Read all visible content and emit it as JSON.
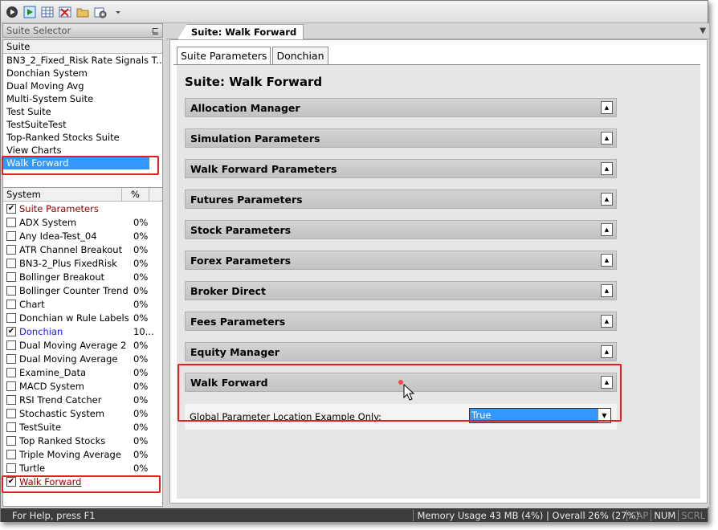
{
  "toolbar": {
    "icons": [
      "run-icon",
      "run-suite-icon",
      "grid-icon",
      "delete-grid-icon",
      "folder-icon",
      "settings-icon",
      "dropdown-arrow-icon"
    ]
  },
  "suite_selector": {
    "title": "Suite Selector",
    "pin_glyph": "⊑",
    "column_header": "Suite",
    "items": [
      {
        "label": "BN3_2_Fixed_Risk Rate Signals T..."
      },
      {
        "label": "Donchian System"
      },
      {
        "label": "Dual Moving Avg"
      },
      {
        "label": "Multi-System Suite"
      },
      {
        "label": "Test Suite"
      },
      {
        "label": "TestSuiteTest"
      },
      {
        "label": "Top-Ranked Stocks Suite"
      },
      {
        "label": "View Charts"
      },
      {
        "label": "Walk Forward"
      }
    ],
    "selected_index": 8
  },
  "system_list": {
    "col_system": "System",
    "col_pct": "%",
    "rows": [
      {
        "name": "Suite Parameters",
        "pct": "",
        "checked": true,
        "style": "red"
      },
      {
        "name": "ADX System",
        "pct": "0%",
        "checked": false,
        "style": ""
      },
      {
        "name": "Any Idea-Test_04",
        "pct": "0%",
        "checked": false,
        "style": ""
      },
      {
        "name": "ATR Channel Breakout",
        "pct": "0%",
        "checked": false,
        "style": ""
      },
      {
        "name": "BN3-2_Plus FixedRisk",
        "pct": "0%",
        "checked": false,
        "style": ""
      },
      {
        "name": "Bollinger Breakout",
        "pct": "0%",
        "checked": false,
        "style": ""
      },
      {
        "name": "Bollinger Counter Trend",
        "pct": "0%",
        "checked": false,
        "style": ""
      },
      {
        "name": "Chart",
        "pct": "0%",
        "checked": false,
        "style": ""
      },
      {
        "name": "Donchian w Rule Labels",
        "pct": "0%",
        "checked": false,
        "style": ""
      },
      {
        "name": "Donchian",
        "pct": "10...",
        "checked": true,
        "style": "blue"
      },
      {
        "name": "Dual Moving Average 2",
        "pct": "0%",
        "checked": false,
        "style": ""
      },
      {
        "name": "Dual Moving Average",
        "pct": "0%",
        "checked": false,
        "style": ""
      },
      {
        "name": "Examine_Data",
        "pct": "0%",
        "checked": false,
        "style": ""
      },
      {
        "name": "MACD System",
        "pct": "0%",
        "checked": false,
        "style": ""
      },
      {
        "name": "RSI Trend Catcher",
        "pct": "0%",
        "checked": false,
        "style": ""
      },
      {
        "name": "Stochastic System",
        "pct": "0%",
        "checked": false,
        "style": ""
      },
      {
        "name": "TestSuite",
        "pct": "0%",
        "checked": false,
        "style": ""
      },
      {
        "name": "Top Ranked Stocks",
        "pct": "0%",
        "checked": false,
        "style": ""
      },
      {
        "name": "Triple Moving Average",
        "pct": "0%",
        "checked": false,
        "style": ""
      },
      {
        "name": "Turtle",
        "pct": "0%",
        "checked": false,
        "style": ""
      },
      {
        "name": "Walk Forward",
        "pct": "",
        "checked": true,
        "style": "red-ul"
      }
    ]
  },
  "document": {
    "tab_label": "Suite: Walk Forward",
    "menu_glyph": "▼",
    "sub_tabs": [
      "Suite Parameters",
      "Donchian"
    ],
    "active_sub_tab": 0,
    "panel_title": "Suite: Walk Forward",
    "groups": [
      "Allocation Manager",
      "Simulation Parameters",
      "Walk Forward Parameters",
      "Futures Parameters",
      "Stock Parameters",
      "Forex Parameters",
      "Broker Direct",
      "Fees Parameters",
      "Equity Manager",
      "Walk Forward"
    ],
    "toggle_glyph": "▲",
    "walk_forward_param": {
      "label": "Global Parameter Location Example Only:",
      "value": "True",
      "arrow_glyph": "▼"
    }
  },
  "status_bar": {
    "help": "For Help, press F1",
    "memory": "Memory Usage 43 MB (4%) | Overall 26% (27%)",
    "keys": [
      {
        "label": "CAP",
        "active": false
      },
      {
        "label": "NUM",
        "active": true
      },
      {
        "label": "SCRL",
        "active": false
      }
    ]
  },
  "colors": {
    "selection": "#3399ff",
    "highlight_box": "#e02020",
    "suite_param_text": "#8b0000",
    "donchian_text": "#1a1aff"
  }
}
